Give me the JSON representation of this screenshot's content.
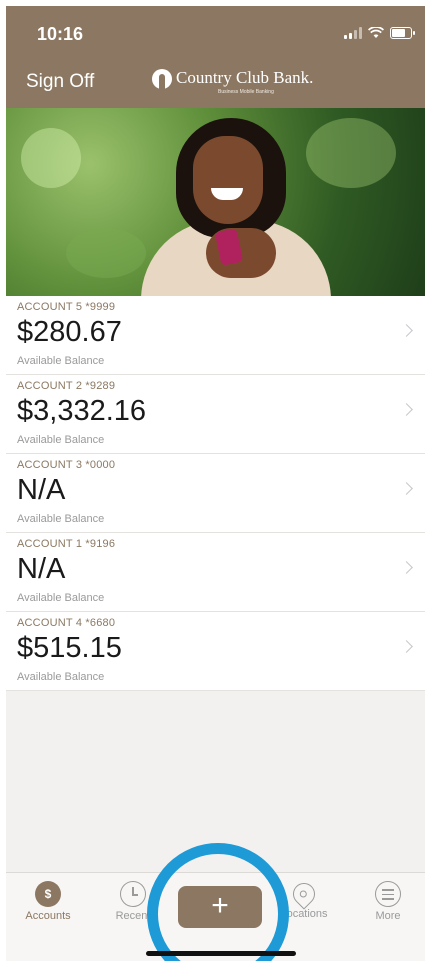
{
  "status_bar": {
    "time": "10:16"
  },
  "header": {
    "sign_off": "Sign Off",
    "bank_name": "Country Club Bank.",
    "bank_subtitle": "Business Mobile Banking"
  },
  "accounts": [
    {
      "name": "ACCOUNT 5 *9999",
      "balance": "$280.67",
      "label": "Available Balance"
    },
    {
      "name": "ACCOUNT 2 *9289",
      "balance": "$3,332.16",
      "label": "Available Balance"
    },
    {
      "name": "ACCOUNT 3 *0000",
      "balance": "N/A",
      "label": "Available Balance"
    },
    {
      "name": "ACCOUNT 1 *9196",
      "balance": "N/A",
      "label": "Available Balance"
    },
    {
      "name": "ACCOUNT 4 *6680",
      "balance": "$515.15",
      "label": "Available Balance"
    }
  ],
  "tabbar": {
    "tabs": [
      {
        "label": "Accounts",
        "icon": "dollar-coin-icon",
        "active": true
      },
      {
        "label": "Recent",
        "icon": "clock-icon",
        "active": false
      },
      {
        "label": "Locations",
        "icon": "location-pin-icon",
        "active": false
      },
      {
        "label": "More",
        "icon": "menu-icon",
        "active": false
      }
    ],
    "add_symbol": "+"
  },
  "colors": {
    "brand": "#8c7862",
    "highlight": "#1e9ad6",
    "background": "#f2f1f0"
  }
}
